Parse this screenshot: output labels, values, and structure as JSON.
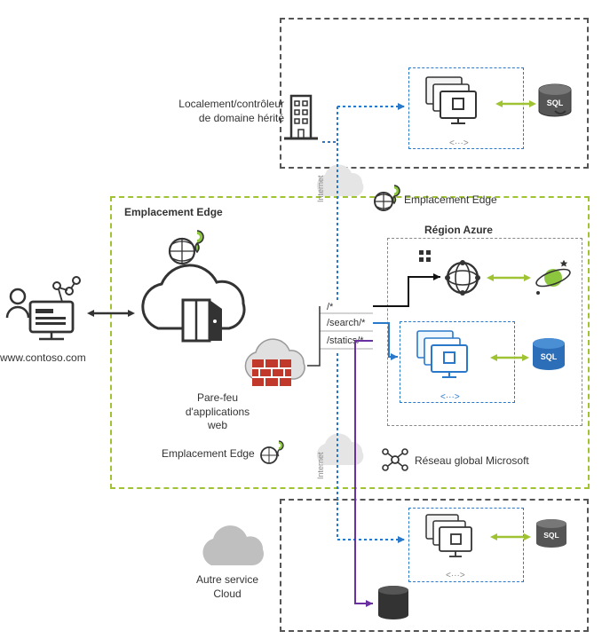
{
  "domain_url": "www.contoso.com",
  "legacy_label": "Localement/contrôleur\nde domaine hérité",
  "edge_label_main": "Emplacement Edge",
  "edge_label_top": "Emplacement Edge",
  "edge_label_bottom": "Emplacement Edge",
  "waf_label": "Pare-feu\nd'applications\nweb",
  "azure_region": "Région Azure",
  "global_network": "Réseau global Microsoft",
  "other_cloud": "Autre service\nCloud",
  "routes": {
    "root": "/*",
    "search": "/search/*",
    "statics": "/statics/*"
  },
  "tags_label": "<···>",
  "internet_label": "Internet",
  "colors": {
    "green": "#9fc332",
    "blue": "#2a78c9",
    "purple": "#6a2fa0",
    "gray": "#555555",
    "sql": "#2c6fb8"
  }
}
